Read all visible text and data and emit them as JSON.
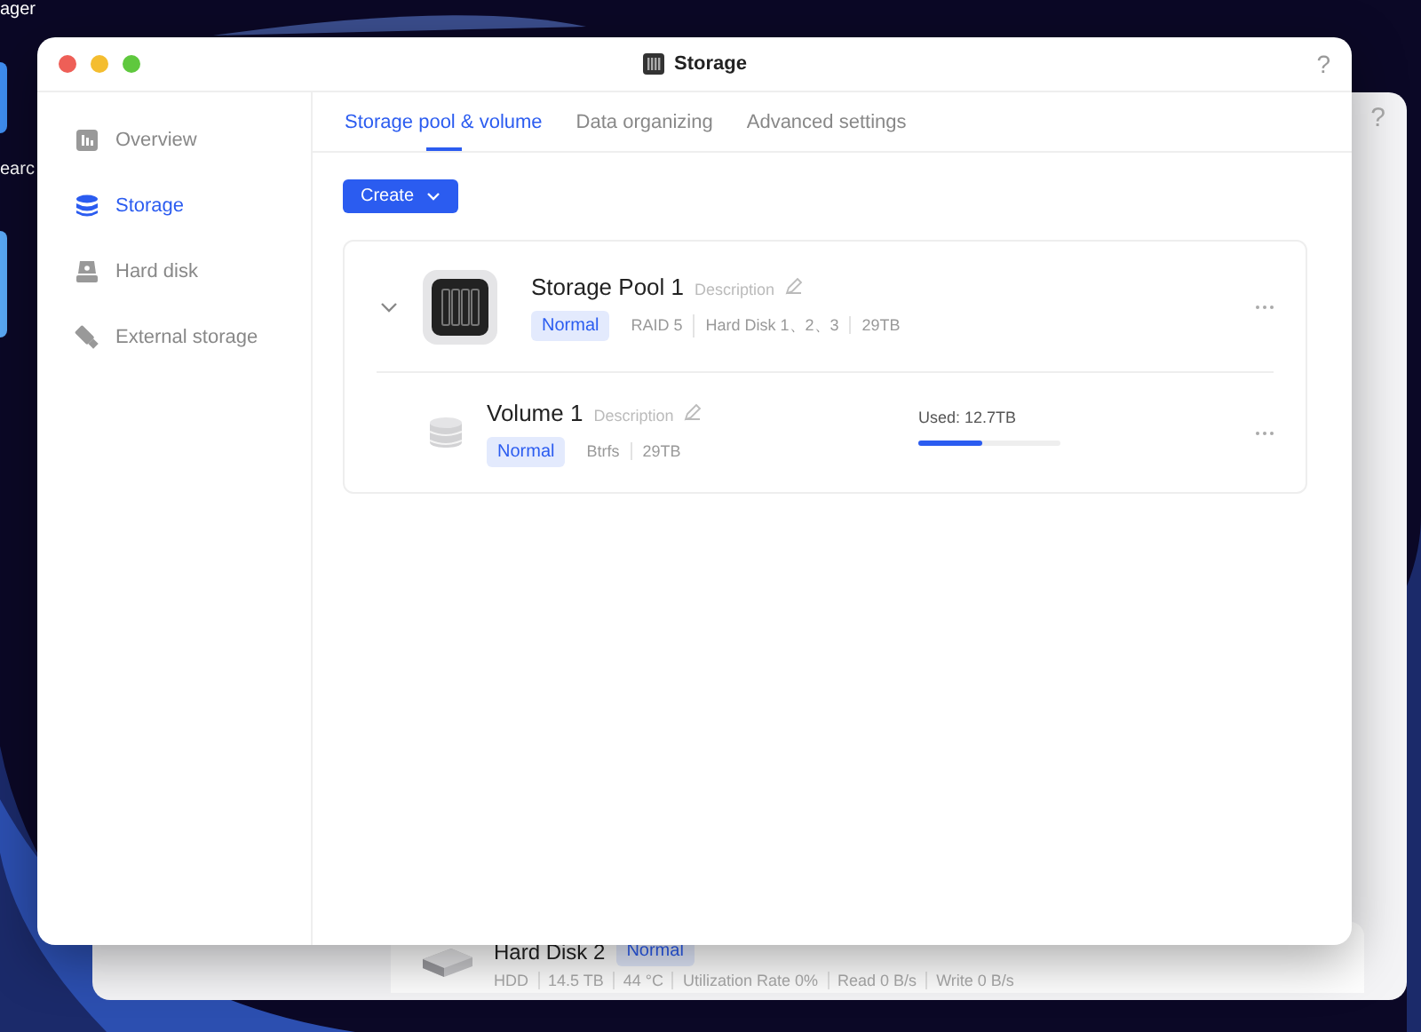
{
  "desktop": {
    "icon_labels": [
      "ager",
      "earc"
    ]
  },
  "background_window": {
    "help": "?",
    "disk": {
      "name": "Hard Disk 2",
      "status": "Normal",
      "details": [
        "HDD",
        "14.5 TB",
        "44 °C",
        "Utilization Rate 0%",
        "Read 0 B/s",
        "Write 0 B/s"
      ]
    }
  },
  "window": {
    "title": "Storage",
    "help": "?"
  },
  "sidebar": {
    "items": [
      {
        "label": "Overview",
        "selected": false
      },
      {
        "label": "Storage",
        "selected": true
      },
      {
        "label": "Hard disk",
        "selected": false
      },
      {
        "label": "External storage",
        "selected": false
      }
    ]
  },
  "tabs": [
    {
      "label": "Storage pool & volume",
      "selected": true
    },
    {
      "label": "Data organizing",
      "selected": false
    },
    {
      "label": "Advanced settings",
      "selected": false
    }
  ],
  "create_button": {
    "label": "Create"
  },
  "pool": {
    "name": "Storage Pool 1",
    "description": "Description",
    "status": "Normal",
    "meta": [
      "RAID 5",
      "Hard Disk 1、2、3",
      "29TB"
    ],
    "expanded": true,
    "volumes": [
      {
        "name": "Volume 1",
        "description": "Description",
        "status": "Normal",
        "meta": [
          "Btrfs",
          "29TB"
        ],
        "used": "Used: 12.7TB",
        "level": 0.45
      }
    ]
  }
}
